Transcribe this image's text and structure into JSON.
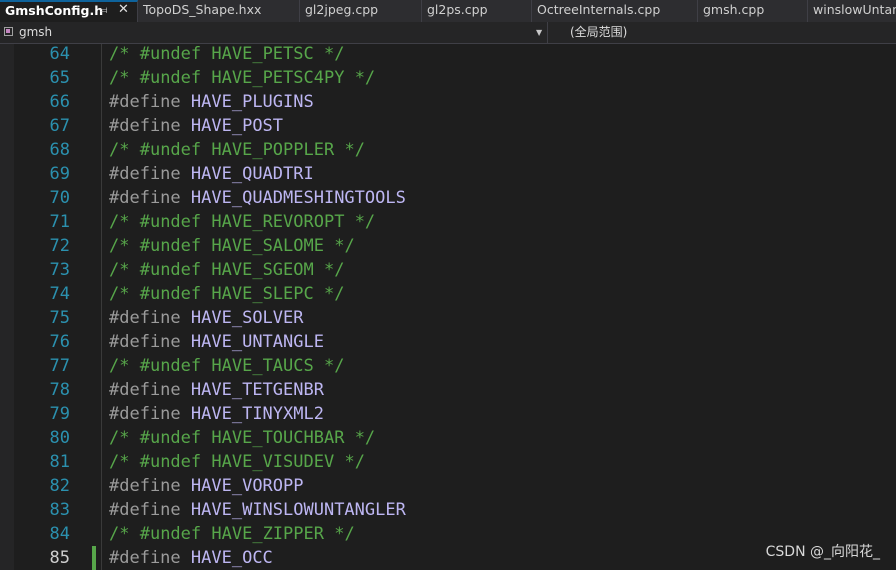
{
  "tabs": [
    {
      "label": "GmshConfig.h",
      "active": true,
      "pin_icon": "pin-icon",
      "close_icon": "close-icon"
    },
    {
      "label": "TopoDS_Shape.hxx",
      "active": false
    },
    {
      "label": "gl2jpeg.cpp",
      "active": false
    },
    {
      "label": "gl2ps.cpp",
      "active": false
    },
    {
      "label": "OctreeInternals.cpp",
      "active": false
    },
    {
      "label": "gmsh.cpp",
      "active": false
    },
    {
      "label": "winslowUntang",
      "active": false
    }
  ],
  "navbar": {
    "project_icon": "project-icon",
    "project": "gmsh",
    "scope": "(全局范围)"
  },
  "colors": {
    "comment": "#57a64a",
    "directive": "#9b9b9b",
    "macro": "#bdb6f2",
    "line_number": "#2b91af",
    "change_bar": "#57a64a"
  },
  "lines": [
    {
      "num": "64",
      "type": "comment",
      "directive": "#undef",
      "macro": "HAVE_PETSC"
    },
    {
      "num": "65",
      "type": "comment",
      "directive": "#undef",
      "macro": "HAVE_PETSC4PY"
    },
    {
      "num": "66",
      "type": "define",
      "directive": "#define",
      "macro": "HAVE_PLUGINS"
    },
    {
      "num": "67",
      "type": "define",
      "directive": "#define",
      "macro": "HAVE_POST"
    },
    {
      "num": "68",
      "type": "comment",
      "directive": "#undef",
      "macro": "HAVE_POPPLER"
    },
    {
      "num": "69",
      "type": "define",
      "directive": "#define",
      "macro": "HAVE_QUADTRI"
    },
    {
      "num": "70",
      "type": "define",
      "directive": "#define",
      "macro": "HAVE_QUADMESHINGTOOLS"
    },
    {
      "num": "71",
      "type": "comment",
      "directive": "#undef",
      "macro": "HAVE_REVOROPT"
    },
    {
      "num": "72",
      "type": "comment",
      "directive": "#undef",
      "macro": "HAVE_SALOME"
    },
    {
      "num": "73",
      "type": "comment",
      "directive": "#undef",
      "macro": "HAVE_SGEOM"
    },
    {
      "num": "74",
      "type": "comment",
      "directive": "#undef",
      "macro": "HAVE_SLEPC"
    },
    {
      "num": "75",
      "type": "define",
      "directive": "#define",
      "macro": "HAVE_SOLVER"
    },
    {
      "num": "76",
      "type": "define",
      "directive": "#define",
      "macro": "HAVE_UNTANGLE"
    },
    {
      "num": "77",
      "type": "comment",
      "directive": "#undef",
      "macro": "HAVE_TAUCS"
    },
    {
      "num": "78",
      "type": "define",
      "directive": "#define",
      "macro": "HAVE_TETGENBR"
    },
    {
      "num": "79",
      "type": "define",
      "directive": "#define",
      "macro": "HAVE_TINYXML2"
    },
    {
      "num": "80",
      "type": "comment",
      "directive": "#undef",
      "macro": "HAVE_TOUCHBAR"
    },
    {
      "num": "81",
      "type": "comment",
      "directive": "#undef",
      "macro": "HAVE_VISUDEV"
    },
    {
      "num": "82",
      "type": "define",
      "directive": "#define",
      "macro": "HAVE_VOROPP"
    },
    {
      "num": "83",
      "type": "define",
      "directive": "#define",
      "macro": "HAVE_WINSLOWUNTANGLER"
    },
    {
      "num": "84",
      "type": "comment",
      "directive": "#undef",
      "macro": "HAVE_ZIPPER"
    },
    {
      "num": "85",
      "type": "define",
      "directive": "#define",
      "macro": "HAVE_OCC",
      "current": true,
      "changed": true
    }
  ],
  "watermark": "CSDN @_向阳花_"
}
